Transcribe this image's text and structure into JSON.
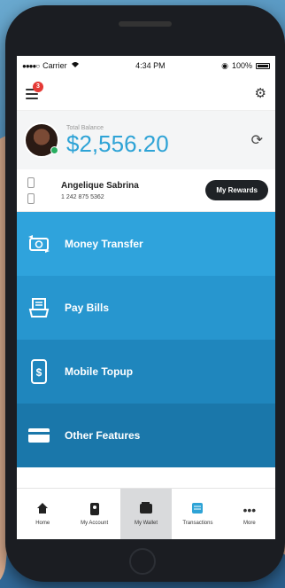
{
  "status_bar": {
    "signal": "●●●●○",
    "carrier": "Carrier",
    "time": "4:34 PM",
    "battery_pct": "100%"
  },
  "header": {
    "notification_count": "3",
    "menu_icon": "hamburger-icon",
    "settings_icon": "gear-icon"
  },
  "balance": {
    "label": "Total Balance",
    "amount": "$2,556.20"
  },
  "user": {
    "name": "Angelique Sabrina",
    "phone": "1 242 875 5362",
    "rewards_label": "My Rewards"
  },
  "menu": {
    "items": [
      {
        "label": "Money Transfer",
        "icon": "money-transfer-icon"
      },
      {
        "label": "Pay Bills",
        "icon": "bills-icon"
      },
      {
        "label": "Mobile Topup",
        "icon": "mobile-dollar-icon"
      },
      {
        "label": "Other Features",
        "icon": "card-icon"
      }
    ]
  },
  "bottom_nav": {
    "items": [
      {
        "label": "Home",
        "icon": "home-icon"
      },
      {
        "label": "My Account",
        "icon": "account-icon"
      },
      {
        "label": "My Wallet",
        "icon": "wallet-icon"
      },
      {
        "label": "Transactions",
        "icon": "transactions-icon"
      },
      {
        "label": "More",
        "icon": "more-icon"
      }
    ],
    "active": "My Wallet"
  },
  "colors": {
    "accent": "#2ea3d6",
    "menu_bg_1": "#2fa3dc",
    "menu_bg_2": "#2796cf",
    "menu_bg_3": "#1f86bd",
    "menu_bg_4": "#1a77aa",
    "badge": "#e53935"
  }
}
